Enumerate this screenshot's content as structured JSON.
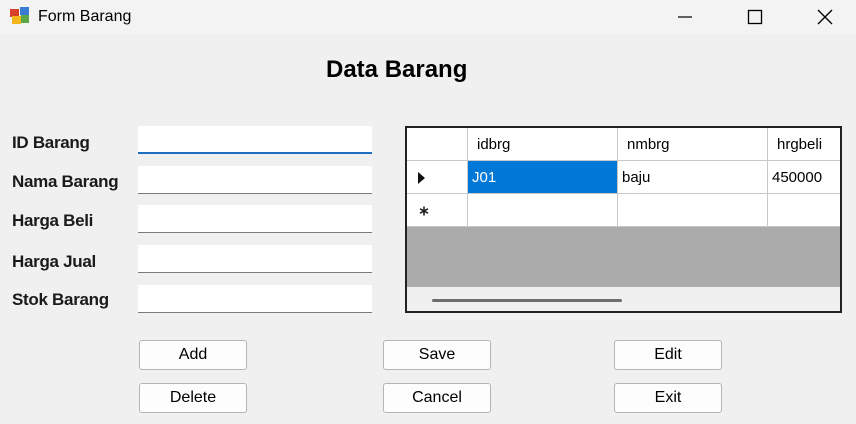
{
  "window": {
    "title": "Form Barang"
  },
  "form": {
    "heading": "Data Barang",
    "fields": [
      {
        "label": "ID Barang",
        "value": ""
      },
      {
        "label": "Nama Barang",
        "value": ""
      },
      {
        "label": "Harga Beli",
        "value": ""
      },
      {
        "label": "Harga Jual",
        "value": ""
      },
      {
        "label": "Stok Barang",
        "value": ""
      }
    ]
  },
  "grid": {
    "columns": [
      "idbrg",
      "nmbrg",
      "hrgbeli"
    ],
    "rows": [
      {
        "idbrg": "J01",
        "nmbrg": "baju",
        "hrgbeli": "450000"
      }
    ],
    "current_row_indicator": "row-pointer-icon",
    "new_row_indicator": "new-row-star-icon"
  },
  "buttons": {
    "add": "Add",
    "save": "Save",
    "edit": "Edit",
    "delete": "Delete",
    "cancel": "Cancel",
    "exit": "Exit"
  },
  "colors": {
    "selection": "#0078d7",
    "focus_underline": "#1f6fc0",
    "grid_background": "#ababab"
  }
}
